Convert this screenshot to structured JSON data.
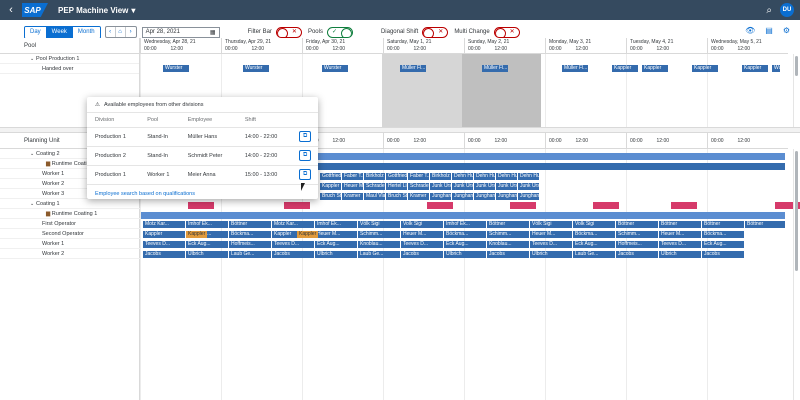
{
  "shell": {
    "back_icon": "back-icon",
    "logo": "SAP",
    "title": "PEP Machine View",
    "avatar": "DU"
  },
  "toolbar": {
    "views": [
      "Day",
      "Week",
      "Month"
    ],
    "active_view": "Week",
    "date": "Apr 28, 2021",
    "filter_bar_label": "Filter Bar",
    "pools_label": "Pools",
    "diagonal_shift_label": "Diagonal Shift",
    "multi_change_label": "Multi Change",
    "toggle_off": "✕",
    "toggle_on": "✓"
  },
  "days": [
    {
      "label": "Wednesday, Apr 28, 21",
      "t1": "00:00",
      "t2": "12:00"
    },
    {
      "label": "Thursday, Apr 29, 21",
      "t1": "00:00",
      "t2": "12:00"
    },
    {
      "label": "Friday, Apr 30, 21",
      "t1": "00:00",
      "t2": "12:00"
    },
    {
      "label": "Saturday, May 1, 21",
      "t1": "00:00",
      "t2": "12:00"
    },
    {
      "label": "Sunday, May 2, 21",
      "t1": "00:00",
      "t2": "12:00"
    },
    {
      "label": "Monday, May 3, 21",
      "t1": "00:00",
      "t2": "12:00"
    },
    {
      "label": "Tuesday, May 4, 21",
      "t1": "00:00",
      "t2": "12:00"
    },
    {
      "label": "Wednesday, May 5, 21",
      "t1": "00:00",
      "t2": "12:00"
    }
  ],
  "pool": {
    "header": "Pool",
    "rows": [
      "Pool Production 1",
      "Handed over"
    ]
  },
  "planning": {
    "header": "Planning Unit",
    "rows": [
      "Coating 2",
      "Runtime Coating 2",
      "Worker 1",
      "Worker 2",
      "Worker 3",
      "Coating 1",
      "Runtime Coating 1",
      "First Operator",
      "Second Operator",
      "Worker 1",
      "Worker 2"
    ]
  },
  "popover": {
    "title": "Available employees from other divisions",
    "columns": [
      "Division",
      "Pool",
      "Employee",
      "Shift"
    ],
    "rows": [
      {
        "division": "Production 1",
        "pool": "Stand-In",
        "employee": "Müller Hans",
        "shift": "14:00 - 22:00"
      },
      {
        "division": "Production 2",
        "pool": "Stand-In",
        "employee": "Schmidt Peter",
        "shift": "14:00 - 22:00"
      },
      {
        "division": "Production 1",
        "pool": "Worker 1",
        "employee": "Meier Anna",
        "shift": "15:00 - 13:00"
      }
    ],
    "link": "Employee search based on qualifications"
  },
  "bars": {
    "pool1": [
      "Wurster",
      "Wurster",
      "Wurster",
      "Müller Fl...",
      "Müller Fl...",
      "Müller Fl...",
      "Kappler",
      "Kappler",
      "Kappler",
      "Kappler",
      "Wurster"
    ],
    "w1": [
      "Gottfried",
      "Faber T...",
      "Birkholz",
      "Gottfried",
      "Faber T...",
      "Birkholz",
      "Dehn Hu...",
      "Dehn Hu...",
      "Dehn Hu...",
      "Dehn Hu..."
    ],
    "w2": [
      "Kappler",
      "Heuer M...",
      "Schrade",
      "Hertel Li...",
      "Schrade",
      "Junk Urs",
      "Junk Urs",
      "Junk Urs",
      "Junk Urs",
      "Junk Urs"
    ],
    "w3": [
      "Bruch St...",
      "Kramer",
      "Maul Vla...",
      "Bruch St...",
      "Kramer",
      "Junghan",
      "Junghan",
      "Junghan",
      "Junghan",
      "Junghan"
    ],
    "fo": [
      "Motz Kar...",
      "Imhof Ek...",
      "Böttner",
      "Motz Kar...",
      "Imhof Ek...",
      "Völk Sigi",
      "Volk Sigi",
      "Imhof Ek...",
      "Böttner",
      "Völk Sigi",
      "Volk Sigi",
      "Böttner",
      "Böttner",
      "Böttner",
      "Böttner"
    ],
    "so": [
      "Kappler",
      "Heuer M...",
      "Böckma...",
      "Kappler",
      "Heuer M...",
      "Schimm...",
      "Heuer M...",
      "Böckma...",
      "Schimm...",
      "Heuer M...",
      "Böckma...",
      "Schimm...",
      "Heuer M...",
      "Böckma..."
    ],
    "w1b": [
      "Teeves D...",
      "Eck Aug...",
      "Hoffmeis...",
      "Teeves D...",
      "Eck Aug...",
      "Knoblau...",
      "Teeves D...",
      "Eck Aug...",
      "Knoblau...",
      "Teeves D...",
      "Eck Aug...",
      "Hoffmeis...",
      "Teeves D...",
      "Eck Aug..."
    ],
    "w2b": [
      "Jacobs",
      "Ulbrich",
      "Laub Ge...",
      "Jacobs",
      "Ulbrich",
      "Laub Ge...",
      "Jacobs",
      "Ulbrich",
      "Jacobs",
      "Ulbrich",
      "Laub Ge...",
      "Jacobs",
      "Ulbrich",
      "Jacobs"
    ]
  }
}
